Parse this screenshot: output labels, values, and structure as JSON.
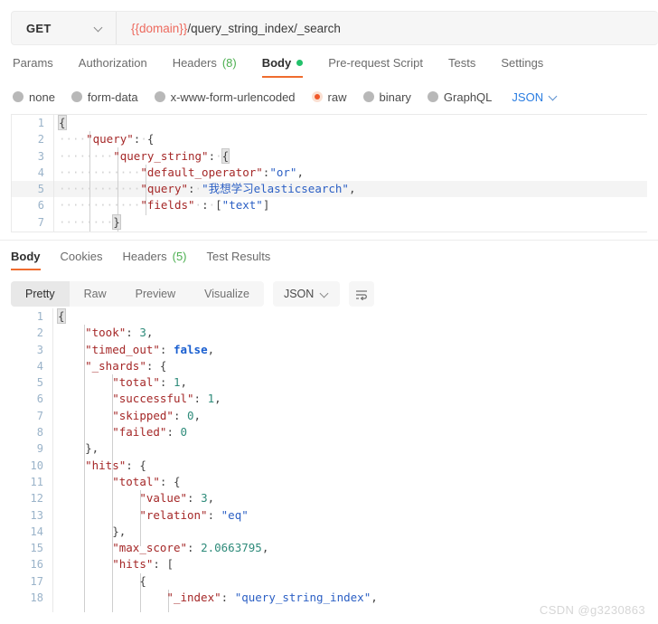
{
  "request": {
    "method": "GET",
    "method_caret": "chevron-down-icon",
    "url_variable": "{{domain}}",
    "url_path": "/query_string_index/_search",
    "tabs": [
      {
        "label": "Params",
        "active": false,
        "dot": false
      },
      {
        "label": "Authorization",
        "active": false,
        "dot": false
      },
      {
        "label": "Headers",
        "count": "(8)",
        "active": false,
        "dot": false
      },
      {
        "label": "Body",
        "active": true,
        "dot": true
      },
      {
        "label": "Pre-request Script",
        "active": false,
        "dot": false
      },
      {
        "label": "Tests",
        "active": false,
        "dot": false
      },
      {
        "label": "Settings",
        "active": false,
        "dot": false
      }
    ],
    "body_types": [
      {
        "label": "none",
        "selected": false
      },
      {
        "label": "form-data",
        "selected": false
      },
      {
        "label": "x-www-form-urlencoded",
        "selected": false
      },
      {
        "label": "raw",
        "selected": true
      },
      {
        "label": "binary",
        "selected": false
      },
      {
        "label": "GraphQL",
        "selected": false
      }
    ],
    "format": "JSON",
    "body_lines": [
      {
        "n": "1",
        "text": "{"
      },
      {
        "n": "2",
        "text": "    \"query\": {"
      },
      {
        "n": "3",
        "text": "        \"query_string\": {"
      },
      {
        "n": "4",
        "text": "            \"default_operator\":\"or\","
      },
      {
        "n": "5",
        "text": "            \"query\": \"我想学习elasticsearch\","
      },
      {
        "n": "6",
        "text": "            \"fields\" : [\"text\"]"
      },
      {
        "n": "7",
        "text": "        }"
      }
    ]
  },
  "response": {
    "tabs": [
      {
        "label": "Body",
        "active": true
      },
      {
        "label": "Cookies",
        "active": false
      },
      {
        "label": "Headers",
        "count": "(5)",
        "active": false
      },
      {
        "label": "Test Results",
        "active": false
      }
    ],
    "view_modes": [
      {
        "label": "Pretty",
        "active": true
      },
      {
        "label": "Raw",
        "active": false
      },
      {
        "label": "Preview",
        "active": false
      },
      {
        "label": "Visualize",
        "active": false
      }
    ],
    "format": "JSON",
    "wrap_icon": "word-wrap-icon",
    "body_lines": [
      {
        "n": "1",
        "text": "{"
      },
      {
        "n": "2",
        "text": "    \"took\": 3,"
      },
      {
        "n": "3",
        "text": "    \"timed_out\": false,"
      },
      {
        "n": "4",
        "text": "    \"_shards\": {"
      },
      {
        "n": "5",
        "text": "        \"total\": 1,"
      },
      {
        "n": "6",
        "text": "        \"successful\": 1,"
      },
      {
        "n": "7",
        "text": "        \"skipped\": 0,"
      },
      {
        "n": "8",
        "text": "        \"failed\": 0"
      },
      {
        "n": "9",
        "text": "    },"
      },
      {
        "n": "10",
        "text": "    \"hits\": {"
      },
      {
        "n": "11",
        "text": "        \"total\": {"
      },
      {
        "n": "12",
        "text": "            \"value\": 3,"
      },
      {
        "n": "13",
        "text": "            \"relation\": \"eq\""
      },
      {
        "n": "14",
        "text": "        },"
      },
      {
        "n": "15",
        "text": "        \"max_score\": 2.0663795,"
      },
      {
        "n": "16",
        "text": "        \"hits\": ["
      },
      {
        "n": "17",
        "text": "            {"
      },
      {
        "n": "18",
        "text": "                \"_index\": \"query_string_index\","
      }
    ]
  },
  "watermark": "CSDN @g3230863",
  "colors": {
    "accent": "#ef6c2e",
    "variable": "#ed6a5e",
    "json_key": "#a52828",
    "json_string": "#2b5fc4",
    "json_number": "#2e8b7a",
    "json_bool": "#1a5fd0",
    "green_dot": "#23c16b",
    "link_blue": "#2a7de1"
  }
}
